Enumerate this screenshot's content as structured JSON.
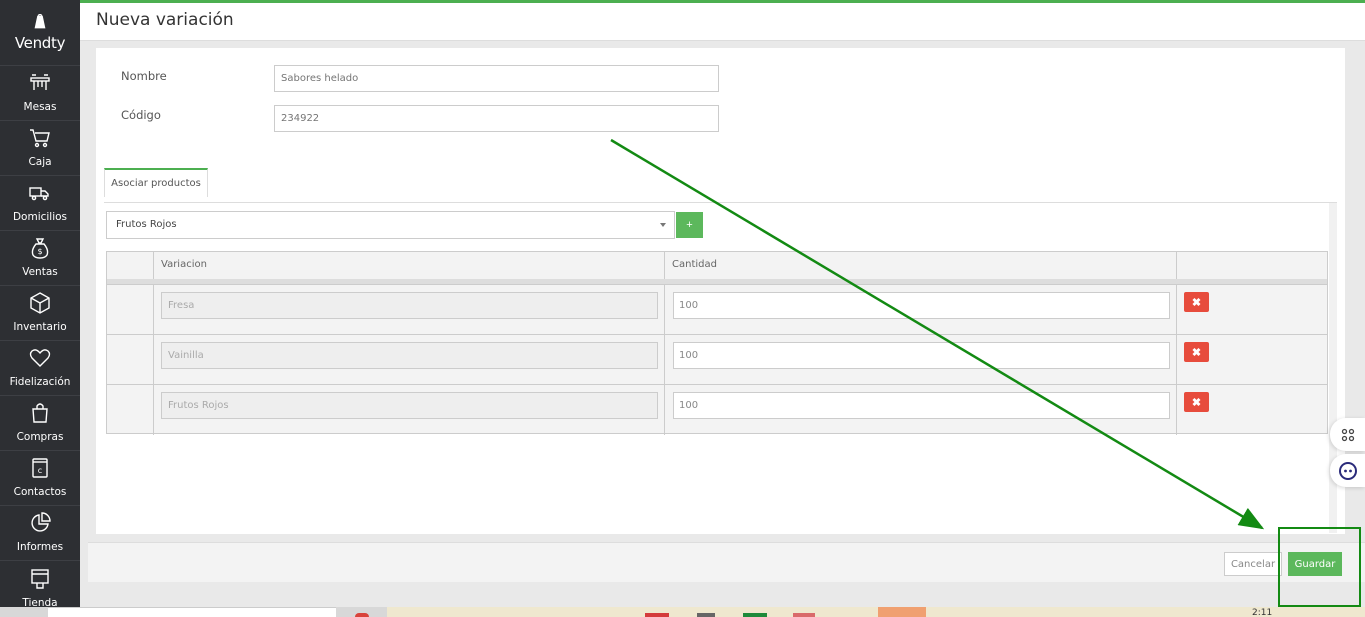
{
  "app": {
    "brand": "Vendty",
    "accent": "#4caf50",
    "sidebar_bg": "#2d2f33"
  },
  "sidebar": {
    "items": [
      {
        "label": "Mesas",
        "icon": "tables-icon"
      },
      {
        "label": "Caja",
        "icon": "cart-icon"
      },
      {
        "label": "Domicilios",
        "icon": "delivery-truck-icon"
      },
      {
        "label": "Ventas",
        "icon": "money-bag-icon"
      },
      {
        "label": "Inventario",
        "icon": "box-icon"
      },
      {
        "label": "Fidelización",
        "icon": "heart-icon"
      },
      {
        "label": "Compras",
        "icon": "shopping-bag-icon"
      },
      {
        "label": "Contactos",
        "icon": "contacts-book-icon"
      },
      {
        "label": "Informes",
        "icon": "pie-chart-icon"
      },
      {
        "label": "Tienda",
        "icon": "store-icon"
      }
    ]
  },
  "header": {
    "title": "Nueva variación"
  },
  "form": {
    "nombre_label": "Nombre",
    "nombre_placeholder": "Sabores helado",
    "codigo_label": "Código",
    "codigo_placeholder": "234922"
  },
  "tabs": [
    {
      "label": "Asociar productos",
      "active": true
    }
  ],
  "product_select": {
    "selected": "Frutos Rojos",
    "add_label": "+"
  },
  "table": {
    "columns": [
      "",
      "Variacion",
      "Cantidad",
      ""
    ],
    "rows": [
      {
        "variacion": "Fresa",
        "cantidad": "100"
      },
      {
        "variacion": "Vainilla",
        "cantidad": "100"
      },
      {
        "variacion": "Frutos Rojos",
        "cantidad": "100"
      }
    ],
    "delete_label": "✖"
  },
  "footer": {
    "cancel_label": "Cancelar",
    "save_label": "Guardar"
  },
  "taskbar": {
    "clock": "2:11"
  },
  "annotation": {
    "color": "#138a13"
  }
}
